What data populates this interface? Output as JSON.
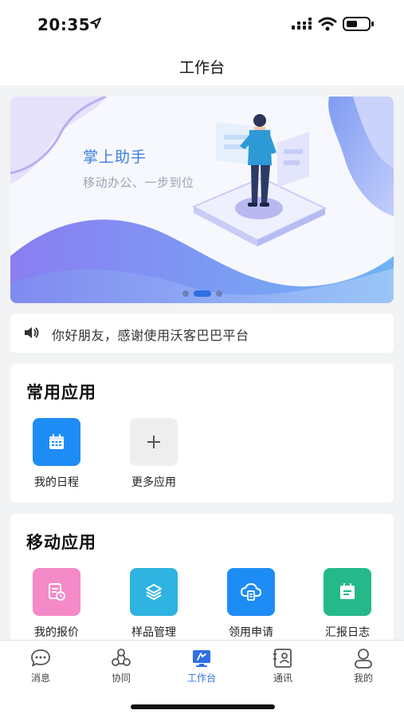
{
  "status_bar": {
    "time": "20:35",
    "icons": [
      "location-arrow-icon",
      "cellular-signal-icon",
      "wifi-icon",
      "battery-icon"
    ]
  },
  "nav": {
    "title": "工作台"
  },
  "banner": {
    "title": "掌上助手",
    "subtitle": "移动办公、一步到位",
    "page_count": 3,
    "active_page": 2
  },
  "notice": {
    "icon": "speaker-icon",
    "text": "你好朋友，感谢使用沃客巴巴平台"
  },
  "common_apps": {
    "title": "常用应用",
    "items": [
      {
        "label": "我的日程",
        "icon": "calendar-icon",
        "color": "#1e8cf5"
      },
      {
        "label": "更多应用",
        "icon": "plus-icon",
        "color": "#eeeeee"
      }
    ]
  },
  "mobile_apps": {
    "title": "移动应用",
    "items": [
      {
        "label": "我的报价",
        "icon": "quote-doc-icon",
        "color": "#f48ac8"
      },
      {
        "label": "样品管理",
        "icon": "layers-icon",
        "color": "#2fb3e0"
      },
      {
        "label": "领用申请",
        "icon": "cloud-doc-icon",
        "color": "#1e8cf5"
      },
      {
        "label": "汇报日志",
        "icon": "report-log-icon",
        "color": "#25b98a"
      }
    ]
  },
  "tabbar": {
    "active": "工作台",
    "accent": "#2f6fe4",
    "items": [
      {
        "label": "消息",
        "icon": "chat-bubble-icon"
      },
      {
        "label": "协同",
        "icon": "collaboration-icon"
      },
      {
        "label": "工作台",
        "icon": "workbench-icon"
      },
      {
        "label": "通讯",
        "icon": "contacts-icon"
      },
      {
        "label": "我的",
        "icon": "profile-icon"
      }
    ]
  }
}
